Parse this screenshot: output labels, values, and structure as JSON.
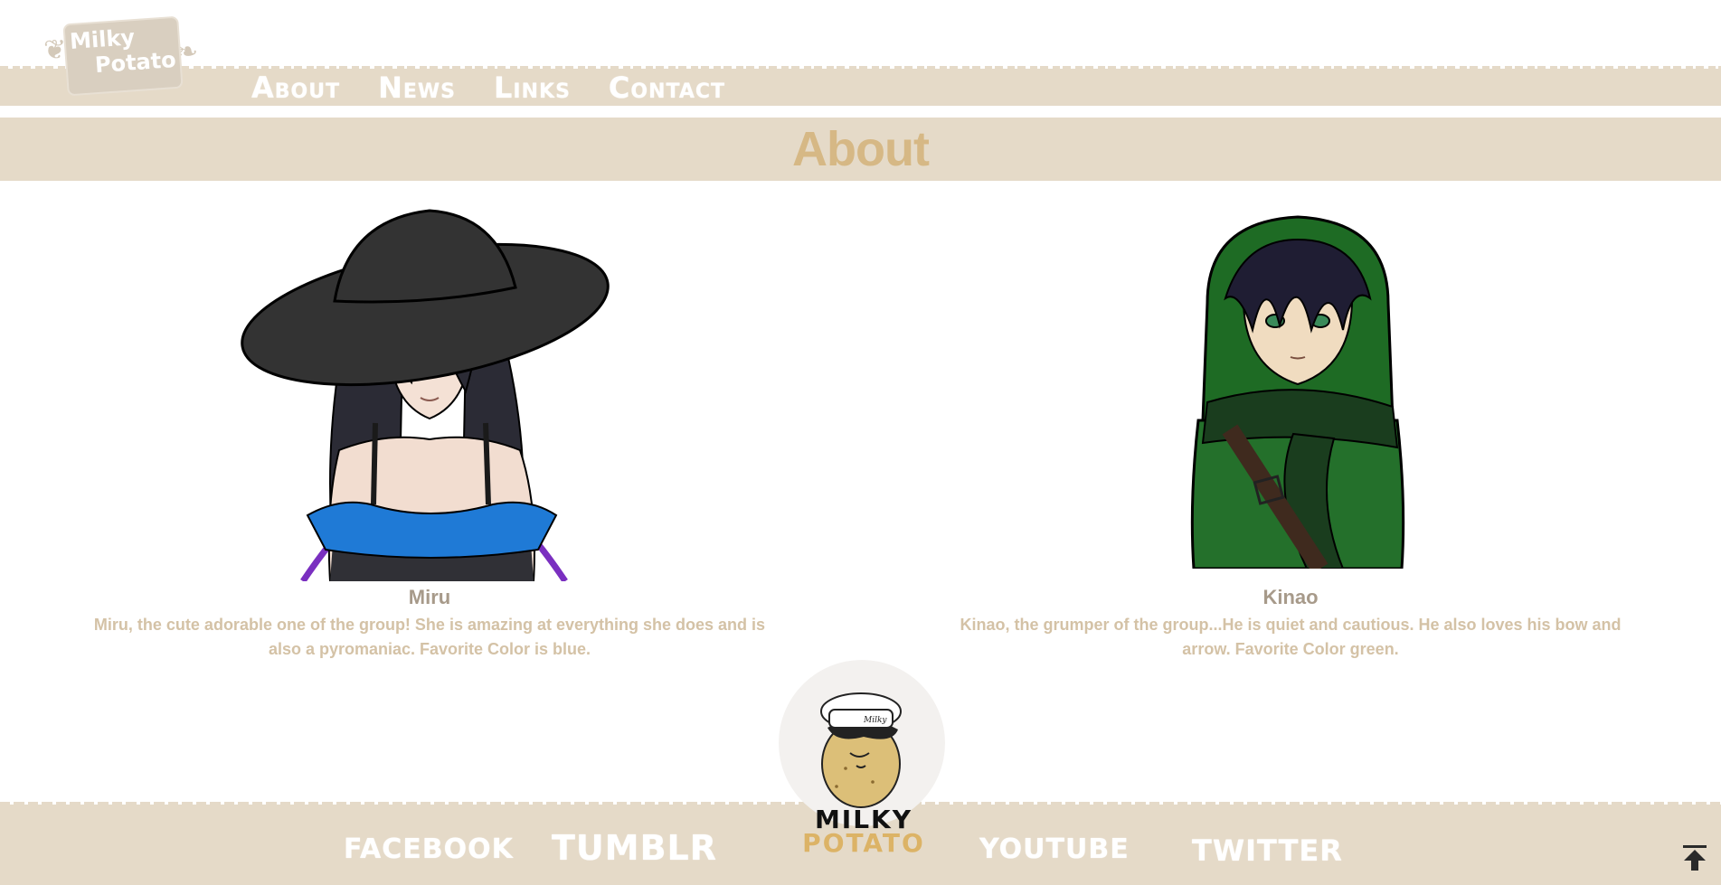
{
  "logo": {
    "line1": "Milky",
    "line2": "Potato"
  },
  "nav": {
    "items": [
      "About",
      "News",
      "Links",
      "Contact"
    ]
  },
  "page": {
    "title": "About"
  },
  "members": [
    {
      "name": "Miru",
      "description": "Miru, the cute adorable one of the group! She is amazing at everything she does and is also a pyromaniac. Favorite Color is blue."
    },
    {
      "name": "Kinao",
      "description": "Kinao, the grumper of the group...He is quiet and cautious. He also loves his bow and arrow. Favorite Color green."
    }
  ],
  "footer": {
    "links": [
      "FACEBOOK",
      "TUMBLR",
      "YOUTUBE",
      "TWITTER"
    ],
    "brand_line1": "MILKY",
    "brand_line2": "POTATO",
    "hat_text": "Milky",
    "back_to_top_icon": "arrow-up-bar-icon"
  },
  "colors": {
    "band": "#e5dac8",
    "title": "#d6b885",
    "name": "#a79a8a",
    "desc": "#d4c2a6",
    "brand_gold": "#dcb366"
  }
}
